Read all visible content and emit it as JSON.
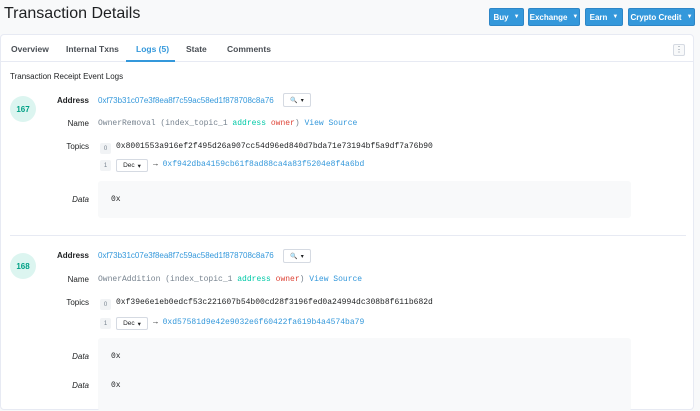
{
  "header": {
    "title": "Transaction Details",
    "buttons": [
      {
        "label": "Buy",
        "icon": "chevron-down-icon"
      },
      {
        "label": "Exchange",
        "icon": "chevron-down-icon"
      },
      {
        "label": "Earn",
        "icon": "chevron-down-icon"
      },
      {
        "label": "Crypto Credit",
        "icon": "chevron-down-icon"
      }
    ]
  },
  "tabs": [
    {
      "label": "Overview",
      "active": false
    },
    {
      "label": "Internal Txns",
      "active": false
    },
    {
      "label": "Logs (5)",
      "active": true
    },
    {
      "label": "State",
      "active": false
    },
    {
      "label": "Comments",
      "active": false
    }
  ],
  "section_title": "Transaction Receipt Event Logs",
  "labels": {
    "address": "Address",
    "name": "Name",
    "topics": "Topics",
    "data": "Data"
  },
  "logs": [
    {
      "index": "167",
      "address": "0xf73b31c07e3f8ea8f7c59ac58ed1f878708c8a76",
      "name": {
        "event": "OwnerRemoval",
        "open": " (index_topic_1 ",
        "type": "address",
        "param": "owner",
        "close": ")",
        "view_source": "View Source"
      },
      "topics": [
        {
          "idx": "0",
          "value": "0x8001553a916ef2f495d26a907cc54d96ed840d7bda71e73194bf5a9df7a76b90"
        },
        {
          "idx": "1",
          "format": "Dec",
          "arrow": "→",
          "value": "0xf942dba4159cb61f8ad88ca4a83f5204e8f4a6bd"
        }
      ],
      "data": [
        "0x"
      ]
    },
    {
      "index": "168",
      "address": "0xf73b31c07e3f8ea8f7c59ac58ed1f878708c8a76",
      "name": {
        "event": "OwnerAddition",
        "open": " (index_topic_1 ",
        "type": "address",
        "param": "owner",
        "close": ")",
        "view_source": "View Source"
      },
      "topics": [
        {
          "idx": "0",
          "value": "0xf39e6e1eb0edcf53c221607b54b00cd28f3196fed0a24994dc308b8f611b682d"
        },
        {
          "idx": "1",
          "format": "Dec",
          "arrow": "→",
          "value": "0xd57581d9e42e9032e6f60422fa619b4a4574ba79"
        }
      ],
      "data": [
        "0x",
        "0x"
      ]
    }
  ],
  "colors": {
    "accent": "#3498db",
    "badge_bg": "#dcf5f0",
    "badge_text": "#00a186",
    "keyword": "#00c9a7",
    "param": "#de4437"
  }
}
